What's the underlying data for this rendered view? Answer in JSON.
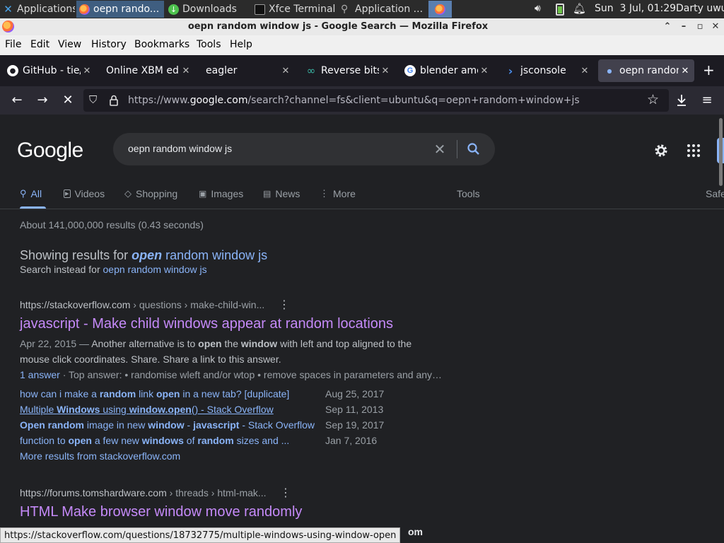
{
  "taskbar": {
    "items": [
      {
        "label": "Applications",
        "icon": "xfce-icon"
      },
      {
        "label": "oepn rando...",
        "icon": "firefox-icon"
      },
      {
        "label": "Downloads",
        "icon": "download-icon"
      },
      {
        "label": "Xfce Terminal",
        "icon": "terminal-icon"
      },
      {
        "label": "Application ...",
        "icon": "search-icon"
      }
    ],
    "clock": "Sun  3 Jul, 01:29",
    "user": "Darty uwu"
  },
  "window": {
    "title": "oepn random window js - Google Search — Mozilla Firefox"
  },
  "menubar": [
    "File",
    "Edit",
    "View",
    "History",
    "Bookmarks",
    "Tools",
    "Help"
  ],
  "tabs": [
    {
      "label": "GitHub - tie/",
      "icon": "github-icon"
    },
    {
      "label": "Online XBM edi",
      "icon": ""
    },
    {
      "label": "eagler",
      "icon": ""
    },
    {
      "label": "Reverse bits",
      "icon": "infinity-icon"
    },
    {
      "label": "blender amo",
      "icon": "google-icon"
    },
    {
      "label": "jsconsole",
      "icon": "chevron-icon"
    },
    {
      "label": "oepn random",
      "icon": "loading-dot-icon"
    }
  ],
  "navbar": {
    "url_prefix": "https://www.",
    "url_host": "google.com",
    "url_rest": "/search?channel=fs&client=ubuntu&q=oepn+random+window+js"
  },
  "google": {
    "logo": "Google",
    "query": "oepn random window js",
    "tabs": [
      "All",
      "Videos",
      "Shopping",
      "Images",
      "News",
      "More"
    ],
    "tools": "Tools",
    "safe": "Safe",
    "stats": "About 141,000,000 results (0.43 seconds)",
    "showing_prefix": "Showing results for ",
    "showing_bold": "open",
    "showing_rest": " random window js",
    "instead_prefix": "Search instead for ",
    "instead_link": "oepn random window js"
  },
  "results": [
    {
      "cite_domain": "https://stackoverflow.com",
      "cite_path": " › questions › make-child-win...",
      "title": "javascript - Make child windows appear at random locations",
      "snippet_date": "Apr 22, 2015 — ",
      "snippet": "Another alternative is to open the window with left and top aligned to the mouse click coordinates. Share. Share a link to this answer.",
      "meta_link": "1 answer",
      "meta_text": " · Top answer: • randomise wleft and/or wtop • remove spaces in parameters and any…",
      "sublinks": [
        {
          "text": "how can i make a random link open in a new tab? [duplicate]",
          "date": "Aug 25, 2017"
        },
        {
          "text": "Multiple Windows using window.open() - Stack Overflow",
          "date": "Sep 11, 2013"
        },
        {
          "text": "Open random image in new window - javascript - Stack Overflow",
          "date": "Sep 19, 2017"
        },
        {
          "text": "function to open a few new windows of random sizes and ...",
          "date": "Jan 7, 2016"
        }
      ],
      "more": "More results from stackoverflow.com"
    },
    {
      "cite_domain": "https://forums.tomshardware.com",
      "cite_path": " › threads › html-mak...",
      "title": "HTML Make browser window move randomly"
    }
  ],
  "statusbar": "https://stackoverflow.com/questions/18732775/multiple-windows-using-window-open",
  "statusbar_trailing": "om"
}
